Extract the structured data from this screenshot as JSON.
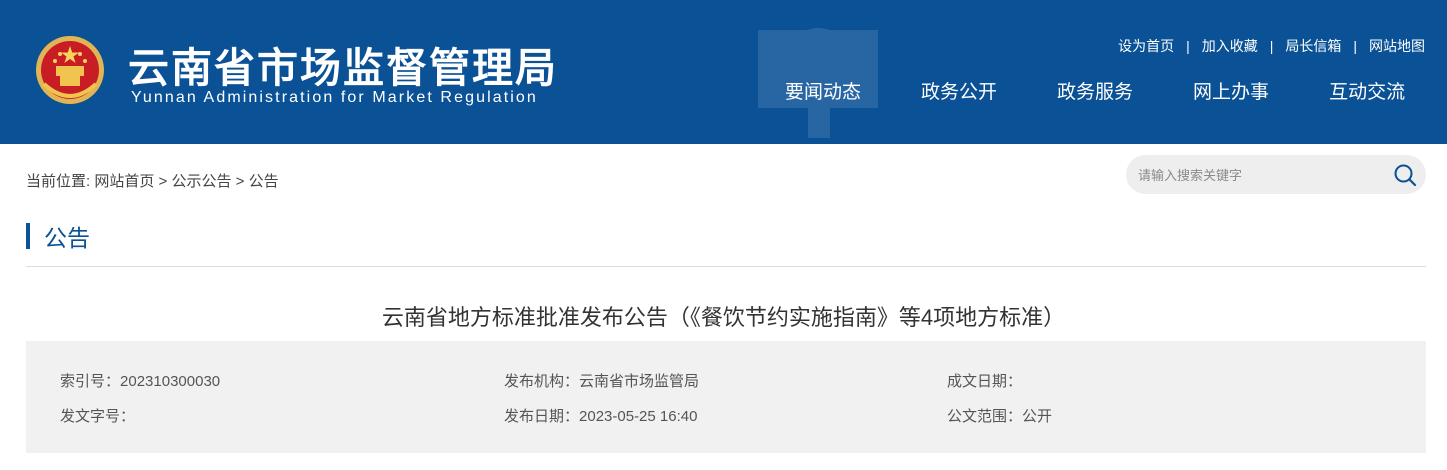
{
  "header": {
    "title": "云南省市场监督管理局",
    "subtitle": "Yunnan Administration for Market Regulation",
    "emblem_icon": "national-emblem-icon",
    "colors": {
      "primary": "#0a5196",
      "text_on_primary": "#ffffff"
    }
  },
  "toplinks": [
    {
      "label": "设为首页"
    },
    {
      "label": "加入收藏"
    },
    {
      "label": "局长信箱"
    },
    {
      "label": "网站地图"
    }
  ],
  "toplink_separator": "|",
  "nav": [
    {
      "label": "要闻动态"
    },
    {
      "label": "政务公开"
    },
    {
      "label": "政务服务"
    },
    {
      "label": "网上办事"
    },
    {
      "label": "互动交流"
    }
  ],
  "breadcrumb": {
    "prefix": "当前位置:",
    "items": [
      "网站首页",
      "公示公告",
      "公告"
    ],
    "separator": ">"
  },
  "search": {
    "placeholder": "请输入搜索关键字",
    "value": "",
    "icon": "search-icon"
  },
  "section": {
    "title": "公告"
  },
  "article": {
    "title": "云南省地方标准批准发布公告（《餐饮节约实施指南》等4项地方标准）"
  },
  "meta": {
    "index_label": "索引号：",
    "index_value": "202310300030",
    "publisher_label": "发布机构：",
    "publisher_value": "云南省市场监管局",
    "created_label": "成文日期：",
    "created_value": "",
    "doc_no_label": "发文字号：",
    "doc_no_value": "",
    "publish_date_label": "发布日期：",
    "publish_date_value": "2023-05-25 16:40",
    "scope_label": "公文范围：",
    "scope_value": "公开"
  }
}
